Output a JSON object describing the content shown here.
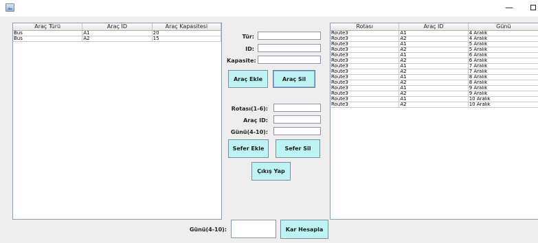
{
  "window": {
    "minimize_glyph": "—"
  },
  "vehicles_table": {
    "columns": [
      "Araç Türü",
      "Araç ID",
      "Araç Kapasitesi"
    ],
    "rows": [
      [
        "Bus",
        "A1",
        "20"
      ],
      [
        "Bus",
        "A2",
        "15"
      ]
    ]
  },
  "vehicle_form": {
    "type_label": "Tür:",
    "id_label": "ID:",
    "capacity_label": "Kapasite:",
    "type_value": "",
    "id_value": "",
    "capacity_value": "",
    "add_button": "Araç Ekle",
    "delete_button": "Araç Sil"
  },
  "trip_form": {
    "route_label": "Rotası(1-6):",
    "vehicle_id_label": "Araç ID:",
    "day_label": "Günü(4-10):",
    "route_value": "",
    "vehicle_id_value": "",
    "day_value": "",
    "add_button": "Sefer Ekle",
    "delete_button": "Sefer Sil",
    "exit_button": "Çıkış Yap"
  },
  "trips_table": {
    "columns": [
      "Rotası",
      "Araç ID",
      "Günü"
    ],
    "rows": [
      [
        "Route3",
        "A1",
        "4 Aralık"
      ],
      [
        "Route3",
        "A2",
        "4 Aralık"
      ],
      [
        "Route3",
        "A1",
        "5  Aralık"
      ],
      [
        "Route3",
        "A2",
        "5 Aralık"
      ],
      [
        "Route3",
        "A1",
        "6 Aralık"
      ],
      [
        "Route3",
        "A2",
        "6 Aralık"
      ],
      [
        "Route3",
        "A1",
        "7 Aralık"
      ],
      [
        "Route3",
        "A2",
        "7 Aralık"
      ],
      [
        "Route3",
        "A1",
        "8 Aralık"
      ],
      [
        "Route3",
        "A2",
        "8 Aralık"
      ],
      [
        "Route3",
        "A1",
        "9 Aralık"
      ],
      [
        "Route3",
        "A2",
        "9 Aralık"
      ],
      [
        "Route3",
        "A1",
        "10 Aralık"
      ],
      [
        "Route3",
        "A2",
        "10 Aralık"
      ]
    ]
  },
  "profit_bar": {
    "day_label": "Günü(4-10):",
    "day_value": "",
    "calculate_button": "Kar Hesapla"
  }
}
